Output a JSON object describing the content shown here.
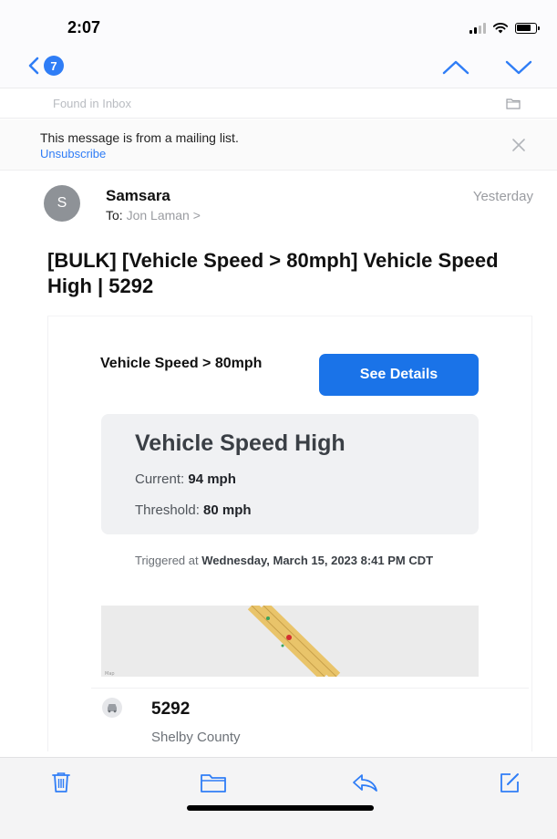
{
  "status_bar": {
    "time": "2:07"
  },
  "nav": {
    "unread_count": "7"
  },
  "folder": {
    "label": "Found in Inbox"
  },
  "mailing_list": {
    "message": "This message is from a mailing list.",
    "unsubscribe": "Unsubscribe"
  },
  "sender": {
    "initial": "S",
    "name": "Samsara",
    "to_label": "To:",
    "to_recipient": "Jon Laman >",
    "date": "Yesterday"
  },
  "subject": "[BULK] [Vehicle Speed > 80mph] Vehicle Speed High | 5292",
  "alert": {
    "title": "Vehicle Speed > 80mph",
    "button": "See Details",
    "heading": "Vehicle Speed High",
    "current_label": "Current:",
    "current_value": "94 mph",
    "threshold_label": "Threshold:",
    "threshold_value": "80 mph",
    "triggered_prefix": "Triggered at",
    "triggered_time": "Wednesday, March 15, 2023 8:41 PM CDT"
  },
  "vehicle": {
    "id": "5292",
    "county": "Shelby County"
  },
  "colors": {
    "accent": "#2f7df6",
    "button": "#1a73e8",
    "road": "#e9c46a"
  },
  "icons": {
    "back": "chevron-left-icon",
    "up": "chevron-up-icon",
    "down": "chevron-down-icon",
    "trash": "trash-icon",
    "folder": "folder-icon",
    "reply": "reply-icon",
    "compose": "compose-icon",
    "vehicle": "car-icon"
  }
}
